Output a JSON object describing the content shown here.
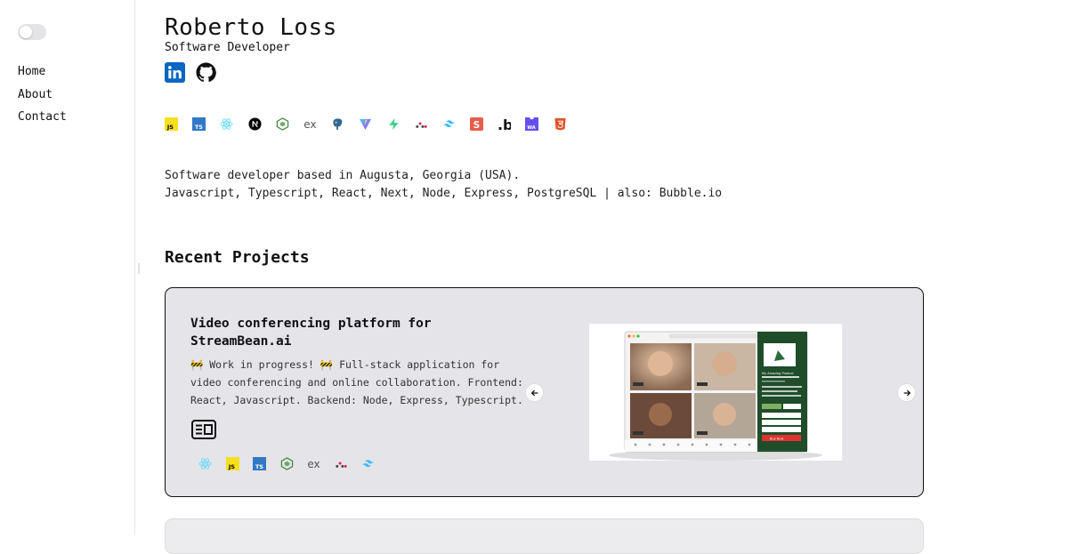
{
  "sidebar": {
    "nav": [
      {
        "label": "Home"
      },
      {
        "label": "About"
      },
      {
        "label": "Contact"
      }
    ]
  },
  "profile": {
    "name": "Roberto Loss",
    "role": "Software Developer",
    "socials": [
      {
        "icon": "linkedin-icon",
        "color": "#0a66c2"
      },
      {
        "icon": "github-icon",
        "color": "#111111"
      }
    ]
  },
  "tech_stack": {
    "express_label": "ex"
  },
  "bio": {
    "line1": "Software developer based in Augusta, Georgia (USA).",
    "line2": "Javascript, Typescript, React, Next, Node, Express, PostgreSQL | also: Bubble.io"
  },
  "projects": {
    "title": "Recent Projects",
    "items": [
      {
        "title": "Video conferencing platform for StreamBean.ai",
        "description": "🚧 Work in progress! 🚧 Full-stack application for video conferencing and online collaboration. Frontend: React, Javascript. Backend: Node, Express, Typescript.",
        "express_label": "ex",
        "preview_product": "My Amazing Product",
        "buy_button": "Buy Now"
      }
    ]
  }
}
